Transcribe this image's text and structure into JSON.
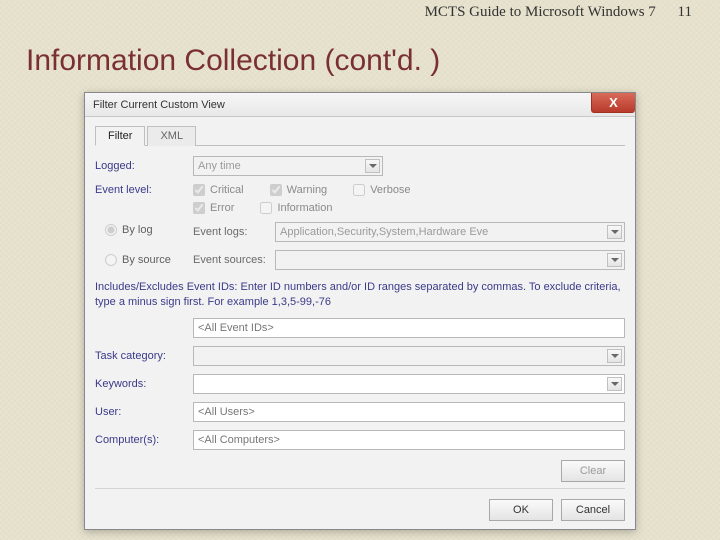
{
  "header": {
    "book": "MCTS Guide to Microsoft Windows 7",
    "page": "11"
  },
  "title": "Information Collection (cont'd. )",
  "dialog": {
    "title": "Filter Current Custom View",
    "close_glyph": "X",
    "tabs": {
      "filter": "Filter",
      "xml": "XML"
    },
    "labels": {
      "logged": "Logged:",
      "event_level": "Event level:",
      "by_log": "By log",
      "by_source": "By source",
      "event_logs": "Event logs:",
      "event_sources": "Event sources:",
      "task_category": "Task category:",
      "keywords": "Keywords:",
      "user": "User:",
      "computers": "Computer(s):"
    },
    "values": {
      "logged": "Any time",
      "event_logs": "Application,Security,System,Hardware Eve",
      "event_sources": "",
      "event_ids_placeholder": "<All Event IDs>",
      "task_category": "",
      "keywords": "",
      "user": "<All Users>",
      "computers": "<All Computers>"
    },
    "checks": {
      "critical": "Critical",
      "warning": "Warning",
      "verbose": "Verbose",
      "error": "Error",
      "information": "Information"
    },
    "desc": "Includes/Excludes Event IDs: Enter ID numbers and/or ID ranges separated by commas. To exclude criteria, type a minus sign first. For example 1,3,5-99,-76",
    "buttons": {
      "clear": "Clear",
      "ok": "OK",
      "cancel": "Cancel"
    }
  }
}
